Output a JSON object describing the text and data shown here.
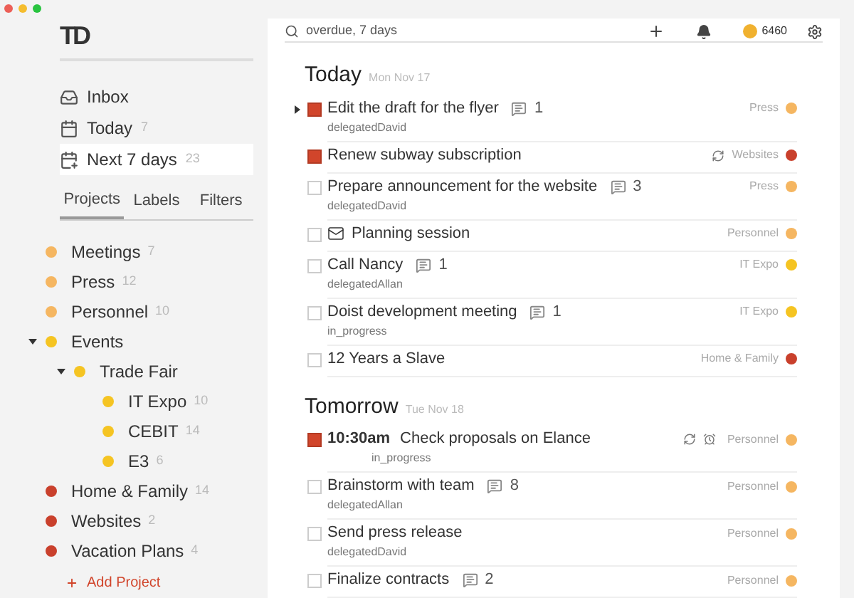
{
  "logo": "TD",
  "nav": [
    {
      "label": "Inbox",
      "kind": "inbox",
      "selected": false
    },
    {
      "label": "Today",
      "count": "7",
      "kind": "today",
      "selected": false
    },
    {
      "label": "Next 7 days",
      "count": "23",
      "kind": "week",
      "selected": true
    }
  ],
  "tabs": [
    {
      "label": "Projects",
      "selected": true
    },
    {
      "label": "Labels",
      "selected": false
    },
    {
      "label": "Filters",
      "selected": false
    }
  ],
  "projects": [
    {
      "name": "Meetings",
      "count": "7",
      "color": "#f5b661"
    },
    {
      "name": "Press",
      "count": "12",
      "color": "#f5b661"
    },
    {
      "name": "Personnel",
      "count": "10",
      "color": "#f5b661"
    },
    {
      "name": "Events",
      "color": "#f5c422",
      "expanded": true,
      "children": [
        {
          "name": "Trade Fair",
          "color": "#f5c422",
          "expanded": true,
          "children": [
            {
              "name": "IT Expo",
              "count": "10",
              "color": "#f5c422"
            },
            {
              "name": "CEBIT",
              "count": "14",
              "color": "#f5c422"
            },
            {
              "name": "E3",
              "count": "6",
              "color": "#f5c422"
            }
          ]
        }
      ]
    },
    {
      "name": "Home & Family",
      "count": "14",
      "color": "#c9402c"
    },
    {
      "name": "Websites",
      "count": "2",
      "color": "#c9402c"
    },
    {
      "name": "Vacation Plans",
      "count": "4",
      "color": "#c9402c"
    }
  ],
  "add_project": "Add Project",
  "search": {
    "value": "overdue, 7 days"
  },
  "karma": "6460",
  "sections": [
    {
      "title": "Today",
      "date": "Mon Nov 17",
      "tasks": [
        {
          "title": "Edit the draft for the flyer",
          "comments": "1",
          "note": "delegatedDavid",
          "project": "Press",
          "color": "#f5b661",
          "flagged": true,
          "expandable": true,
          "recurring": false,
          "reminder": false,
          "email": false
        },
        {
          "title": "Renew subway subscription",
          "project": "Websites",
          "color": "#c9402c",
          "flagged": true,
          "expandable": false,
          "recurring": true,
          "reminder": false,
          "email": false
        },
        {
          "title": "Prepare announcement for the website",
          "comments": "3",
          "note": "delegatedDavid",
          "project": "Press",
          "color": "#f5b661",
          "flagged": false,
          "expandable": false,
          "recurring": false,
          "reminder": false,
          "email": false
        },
        {
          "title": "Planning session",
          "project": "Personnel",
          "color": "#f5b661",
          "flagged": false,
          "expandable": false,
          "recurring": false,
          "reminder": false,
          "email": true
        },
        {
          "title": "Call Nancy",
          "comments": "1",
          "note": "delegatedAllan",
          "project": "IT Expo",
          "color": "#f5c422",
          "flagged": false,
          "expandable": false,
          "recurring": false,
          "reminder": false,
          "email": false
        },
        {
          "title": "Doist development meeting",
          "comments": "1",
          "note": "in_progress",
          "project": "IT Expo",
          "color": "#f5c422",
          "flagged": false,
          "expandable": false,
          "recurring": false,
          "reminder": false,
          "email": false
        },
        {
          "title": "12 Years a Slave",
          "project": "Home & Family",
          "color": "#c9402c",
          "flagged": false,
          "expandable": false,
          "recurring": false,
          "reminder": false,
          "email": false
        }
      ]
    },
    {
      "title": "Tomorrow",
      "date": "Tue Nov 18",
      "tasks": [
        {
          "time": "10:30am",
          "title": "Check proposals on Elance",
          "note": "in_progress",
          "project": "Personnel",
          "color": "#f5b661",
          "flagged": true,
          "expandable": false,
          "recurring": true,
          "reminder": true,
          "email": false
        },
        {
          "title": "Brainstorm with team",
          "comments": "8",
          "note": "delegatedAllan",
          "project": "Personnel",
          "color": "#f5b661",
          "flagged": false,
          "expandable": false,
          "recurring": false,
          "reminder": false,
          "email": false
        },
        {
          "title": "Send press release",
          "note": "delegatedDavid",
          "project": "Personnel",
          "color": "#f5b661",
          "flagged": false,
          "expandable": false,
          "recurring": false,
          "reminder": false,
          "email": false
        },
        {
          "title": "Finalize contracts",
          "comments": "2",
          "project": "Personnel",
          "color": "#f5b661",
          "flagged": false,
          "expandable": false,
          "recurring": false,
          "reminder": false,
          "email": false
        }
      ]
    }
  ]
}
